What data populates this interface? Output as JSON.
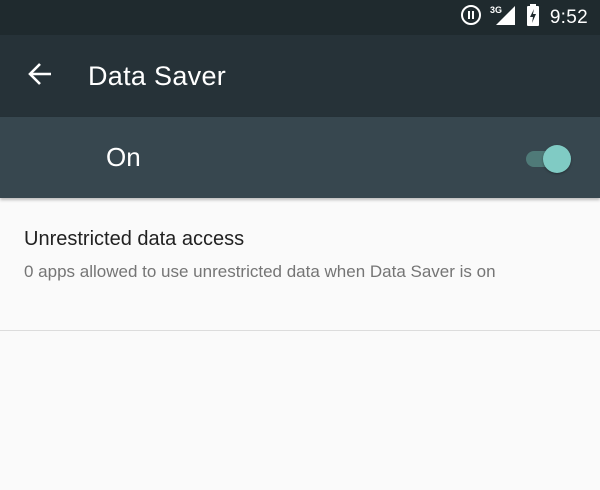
{
  "status_bar": {
    "time": "9:52",
    "network_type": "3G",
    "icons": [
      "data-saver-icon",
      "signal-3g-icon",
      "battery-charging-icon"
    ]
  },
  "app_bar": {
    "title": "Data Saver",
    "back_icon": "arrow-back-icon"
  },
  "master_switch": {
    "label": "On",
    "checked": true,
    "accent_color": "#80cbc4"
  },
  "preferences": [
    {
      "title": "Unrestricted data access",
      "summary": "0 apps allowed to use unrestricted data when Data Saver is on"
    }
  ],
  "colors": {
    "status_bar": "#1f2a2e",
    "app_bar": "#263238",
    "switch_bar": "#37474f",
    "background": "#fafafa"
  }
}
